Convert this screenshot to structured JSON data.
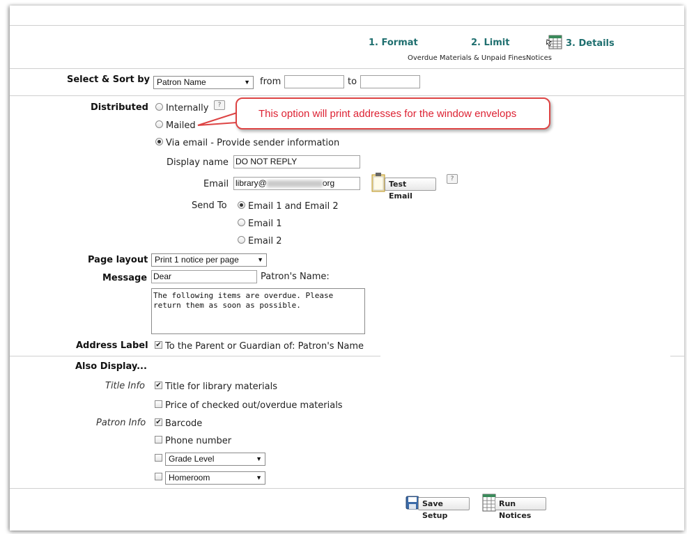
{
  "steps": {
    "format": "1. Format",
    "limit": "2. Limit",
    "details": "3. Details",
    "subtitle": "Overdue Materials & Unpaid FinesNotices"
  },
  "select_sort": {
    "label": "Select & Sort by",
    "field": "Patron Name",
    "from_label": "from",
    "from_value": "",
    "to_label": "to",
    "to_value": ""
  },
  "distributed": {
    "label": "Distributed",
    "internally": "Internally",
    "mailed": "Mailed",
    "via_email": "Via email - Provide sender information",
    "selected": "via_email"
  },
  "callout": "This option will print addresses for the window envelops",
  "email_settings": {
    "display_name_label": "Display name",
    "display_name_value": "DO NOT REPLY",
    "email_label": "Email",
    "email_value": "library@",
    "email_suffix": "org",
    "test_email_label": "Test Email",
    "send_to_label": "Send To",
    "send_to_options": [
      "Email 1 and Email 2",
      "Email 1",
      "Email 2"
    ],
    "send_to_selected": "Email 1 and Email 2"
  },
  "page_layout": {
    "label": "Page layout",
    "value": "Print 1 notice per page"
  },
  "message": {
    "label": "Message",
    "salutation": "Dear",
    "patron_name_label": "Patron's Name:",
    "body": "The following items are overdue. Please return them as soon as possible."
  },
  "address_label": {
    "label": "Address Label",
    "text": "To the Parent or Guardian of: Patron's Name",
    "checked": true
  },
  "also_display": {
    "label": "Also Display...",
    "title_info_label": "Title Info",
    "title_for_library": "Title for library materials",
    "price_checked_out": "Price of checked out/overdue materials",
    "patron_info_label": "Patron Info",
    "barcode": "Barcode",
    "phone_number": "Phone number",
    "grade_level": "Grade Level",
    "homeroom": "Homeroom"
  },
  "footer": {
    "save_setup": "Save Setup",
    "run_notices": "Run Notices"
  }
}
